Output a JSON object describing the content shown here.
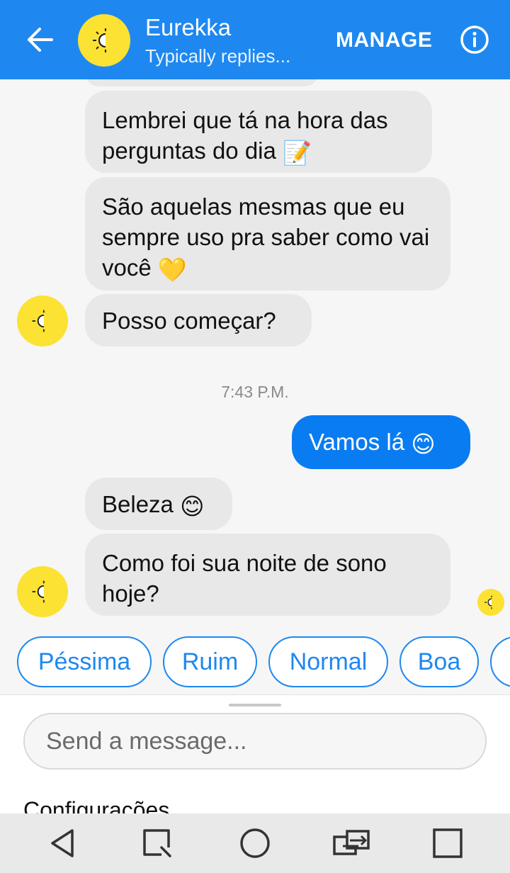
{
  "header": {
    "back_icon": "arrow-left-icon",
    "title": "Eurekka",
    "subtitle": "Typically replies...",
    "manage_label": "MANAGE",
    "info_icon": "info-icon",
    "color": "#1e88f0"
  },
  "messages": [
    {
      "from": "bot",
      "text": "Lembrei que tá na hora das perguntas do dia",
      "emoji": "📝",
      "emoji_icon": "memo-icon"
    },
    {
      "from": "bot",
      "text": "São aquelas mesmas que eu sempre uso pra saber como vai você",
      "emoji": "💛",
      "emoji_icon": "yellow-heart-icon"
    },
    {
      "from": "bot",
      "text": "Posso começar?"
    },
    {
      "from": "user",
      "text": "Vamos lá",
      "emoji": "😊",
      "emoji_icon": "smiling-face-icon"
    },
    {
      "from": "bot",
      "text": "Beleza",
      "emoji": "😊",
      "emoji_icon": "smiling-face-icon"
    },
    {
      "from": "bot",
      "text": "Como foi sua noite de sono hoje?"
    }
  ],
  "timestamp": "7:43 P.M.",
  "quick_replies": [
    "Péssima",
    "Ruim",
    "Normal",
    "Boa"
  ],
  "composer": {
    "placeholder": "Send a message...",
    "menu_label": "Configurações"
  },
  "navbar": {
    "icons": [
      "back-triangle-icon",
      "screenshot-icon",
      "home-circle-icon",
      "switch-app-icon",
      "recents-square-icon"
    ]
  },
  "colors": {
    "accent": "#1e88f0",
    "bot_bubble": "#e8e8e8",
    "user_bubble": "#0a7cf2",
    "avatar": "#fbe233"
  }
}
